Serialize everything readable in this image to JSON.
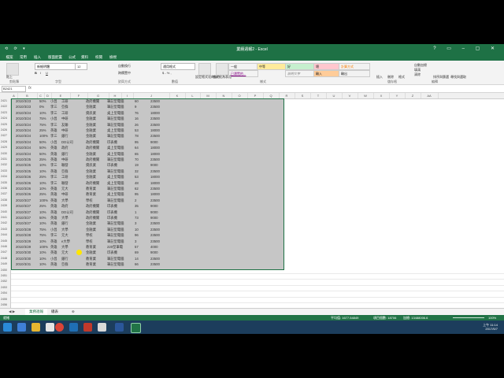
{
  "window": {
    "title": "業績週報2 - Excel",
    "qat": "⟲ ⟳ ▾"
  },
  "tabs": [
    "檔案",
    "常用",
    "插入",
    "版面配置",
    "公式",
    "資料",
    "校閱",
    "檢視"
  ],
  "ribbon": {
    "paste": "貼上",
    "font_name": "新細明體",
    "font_size": "12",
    "wrap": "自動換行",
    "merge": "跨欄置中",
    "number_format": "通用格式",
    "cond_format": "設定格式化的條件",
    "format_table": "格式化為表格",
    "styles": [
      {
        "label": "一般",
        "bg": "#ffffff"
      },
      {
        "label": "中等",
        "bg": "#ffeb9c"
      },
      {
        "label": "好",
        "bg": "#c6efce"
      },
      {
        "label": "壞",
        "bg": "#ffc7ce"
      },
      {
        "label": "計算方式",
        "bg": "#f2f2f2"
      },
      {
        "label": "已瀏覽的...",
        "bg": "#ffffff"
      },
      {
        "label": "說明文字",
        "bg": "#ffffff"
      },
      {
        "label": "輸入",
        "bg": "#ffcc99"
      },
      {
        "label": "輸出",
        "bg": "#f2f2f2"
      }
    ],
    "cells_insert": "插入",
    "cells_delete": "刪除",
    "cells_format": "格式",
    "autosum": "自動加總",
    "fill": "填滿",
    "clear": "清除",
    "sort": "排序與篩選",
    "find": "尋找與選取",
    "groups": [
      "剪貼簿",
      "字型",
      "對齊方式",
      "數值",
      "樣式",
      "儲存格",
      "編輯"
    ]
  },
  "formula": {
    "namebox": "B2421",
    "fx": "fx"
  },
  "columns": [
    "A",
    "B",
    "C",
    "D",
    "E",
    "F",
    "G",
    "H",
    "I",
    "J",
    "K",
    "L",
    "M",
    "N",
    "O",
    "P",
    "Q",
    "R",
    "S",
    "T",
    "U",
    "V",
    "W",
    "X",
    "Y",
    "Z",
    "AA"
  ],
  "rows": [
    {
      "n": "2421",
      "date": "2010/3/23",
      "p": "50%",
      "who": "小昌",
      "cust": "工研",
      "type": "政府機關",
      "item": "筆記型電腦",
      "qty": "60",
      "price": "23500"
    },
    {
      "n": "2422",
      "date": "2010/3/23",
      "p": "0%",
      "who": "李三",
      "cust": "亞群",
      "type": "金融業",
      "item": "筆記型電腦",
      "qty": "9",
      "price": "23500"
    },
    {
      "n": "2423",
      "date": "2010/3/24",
      "p": "10%",
      "who": "李三",
      "cust": "工研",
      "type": "資訊業",
      "item": "桌上型電腦",
      "qty": "76",
      "price": "18000"
    },
    {
      "n": "2424",
      "date": "2010/3/24",
      "p": "75%",
      "who": "小昌",
      "cust": "中研",
      "type": "金融業",
      "item": "筆記型電腦",
      "qty": "16",
      "price": "23500"
    },
    {
      "n": "2425",
      "date": "2010/3/24",
      "p": "75%",
      "who": "李三",
      "cust": "友聯",
      "type": "金融業",
      "item": "筆記型電腦",
      "qty": "26",
      "price": "23500"
    },
    {
      "n": "2426",
      "date": "2010/3/24",
      "p": "25%",
      "who": "英雄",
      "cust": "中研",
      "type": "金融業",
      "item": "桌上型電腦",
      "qty": "53",
      "price": "18000"
    },
    {
      "n": "2427",
      "date": "2010/3/24",
      "p": "100%",
      "who": "李三",
      "cust": "銀行",
      "type": "金融業",
      "item": "筆記型電腦",
      "qty": "78",
      "price": "23500"
    },
    {
      "n": "2428",
      "date": "2010/3/24",
      "p": "50%",
      "who": "小昌",
      "cust": "DD公司",
      "type": "政府機關",
      "item": "印表機",
      "qty": "95",
      "price": "9000"
    },
    {
      "n": "2429",
      "date": "2010/3/24",
      "p": "50%",
      "who": "英雄",
      "cust": "政府",
      "type": "政府機關",
      "item": "桌上型電腦",
      "qty": "64",
      "price": "18000"
    },
    {
      "n": "2430",
      "date": "2010/3/24",
      "p": "50%",
      "who": "英雄",
      "cust": "銀行",
      "type": "金融業",
      "item": "桌上型電腦",
      "qty": "65",
      "price": "18000"
    },
    {
      "n": "2431",
      "date": "2010/3/25",
      "p": "25%",
      "who": "英雄",
      "cust": "中研",
      "type": "政府機關",
      "item": "筆記型電腦",
      "qty": "70",
      "price": "23500"
    },
    {
      "n": "2432",
      "date": "2010/3/25",
      "p": "10%",
      "who": "李三",
      "cust": "聯發",
      "type": "資訊業",
      "item": "印表機",
      "qty": "19",
      "price": "9000"
    },
    {
      "n": "2433",
      "date": "2010/3/25",
      "p": "10%",
      "who": "英雄",
      "cust": "亞群",
      "type": "金融業",
      "item": "筆記型電腦",
      "qty": "32",
      "price": "23500"
    },
    {
      "n": "2434",
      "date": "2010/3/26",
      "p": "25%",
      "who": "李三",
      "cust": "工研",
      "type": "金融業",
      "item": "桌上型電腦",
      "qty": "53",
      "price": "18000"
    },
    {
      "n": "2435",
      "date": "2010/3/26",
      "p": "10%",
      "who": "李三",
      "cust": "聯發",
      "type": "政府機關",
      "item": "桌上型電腦",
      "qty": "48",
      "price": "18000"
    },
    {
      "n": "2436",
      "date": "2010/3/26",
      "p": "10%",
      "who": "英雄",
      "cust": "元大",
      "type": "教育業",
      "item": "筆記型電腦",
      "qty": "62",
      "price": "23500"
    },
    {
      "n": "2437",
      "date": "2010/3/26",
      "p": "25%",
      "who": "英雄",
      "cust": "中研",
      "type": "教育業",
      "item": "桌上型電腦",
      "qty": "95",
      "price": "18000"
    },
    {
      "n": "2438",
      "date": "2010/3/27",
      "p": "100%",
      "who": "英雄",
      "cust": "大學",
      "type": "學校",
      "item": "筆記型電腦",
      "qty": "2",
      "price": "23500"
    },
    {
      "n": "2439",
      "date": "2010/3/27",
      "p": "25%",
      "who": "英雄",
      "cust": "政府",
      "type": "政府機關",
      "item": "印表機",
      "qty": "35",
      "price": "9000"
    },
    {
      "n": "2440",
      "date": "2010/3/27",
      "p": "10%",
      "who": "英雄",
      "cust": "DD公司",
      "type": "政府機關",
      "item": "印表機",
      "qty": "1",
      "price": "9000"
    },
    {
      "n": "2441",
      "date": "2010/3/27",
      "p": "50%",
      "who": "英雄",
      "cust": "大學",
      "type": "政府機關",
      "item": "印表機",
      "qty": "73",
      "price": "9000"
    },
    {
      "n": "2442",
      "date": "2010/3/27",
      "p": "10%",
      "who": "英雄",
      "cust": "銀行",
      "type": "金融業",
      "item": "筆記型電腦",
      "qty": "3",
      "price": "23500"
    },
    {
      "n": "2443",
      "date": "2010/3/28",
      "p": "75%",
      "who": "小昌",
      "cust": "大學",
      "type": "金融業",
      "item": "筆記型電腦",
      "qty": "10",
      "price": "23500"
    },
    {
      "n": "2444",
      "date": "2010/3/28",
      "p": "75%",
      "who": "李三",
      "cust": "元大",
      "type": "學校",
      "item": "筆記型電腦",
      "qty": "96",
      "price": "23500"
    },
    {
      "n": "2445",
      "date": "2010/3/29",
      "p": "10%",
      "who": "英雄",
      "cust": "e大學",
      "type": "學校",
      "item": "筆記型電腦",
      "qty": "3",
      "price": "23500"
    },
    {
      "n": "2446",
      "date": "2010/3/29",
      "p": "100%",
      "who": "英雄",
      "cust": "大學",
      "type": "教育業",
      "item": "220型筆電",
      "qty": "57",
      "price": "4000"
    },
    {
      "n": "2447",
      "date": "2010/3/30",
      "p": "10%",
      "who": "英雄",
      "cust": "元大",
      "type": "金融業",
      "item": "印表機",
      "qty": "69",
      "price": "9000"
    },
    {
      "n": "2448",
      "date": "2010/3/30",
      "p": "10%",
      "who": "小昌",
      "cust": "銀行",
      "type": "教育業",
      "item": "筆記型電腦",
      "qty": "14",
      "price": "23500"
    },
    {
      "n": "2449",
      "date": "2010/3/31",
      "p": "10%",
      "who": "英雄",
      "cust": "亞群",
      "type": "教育業",
      "item": "筆記型電腦",
      "qty": "66",
      "price": "23500"
    }
  ],
  "empty_rows": [
    "2450",
    "2451",
    "2452",
    "2453",
    "2454",
    "2455",
    "2456",
    "2457"
  ],
  "sheet_tabs": [
    "業務週報",
    "總表"
  ],
  "status": {
    "ready": "就緒",
    "average": "平均值: 1677.54849",
    "count": "項目個數: 18706",
    "sum": "加總: 13488006.6",
    "zoom": "100%"
  },
  "clock": {
    "time": "上午 11:14",
    "date": "2017/5/7"
  }
}
